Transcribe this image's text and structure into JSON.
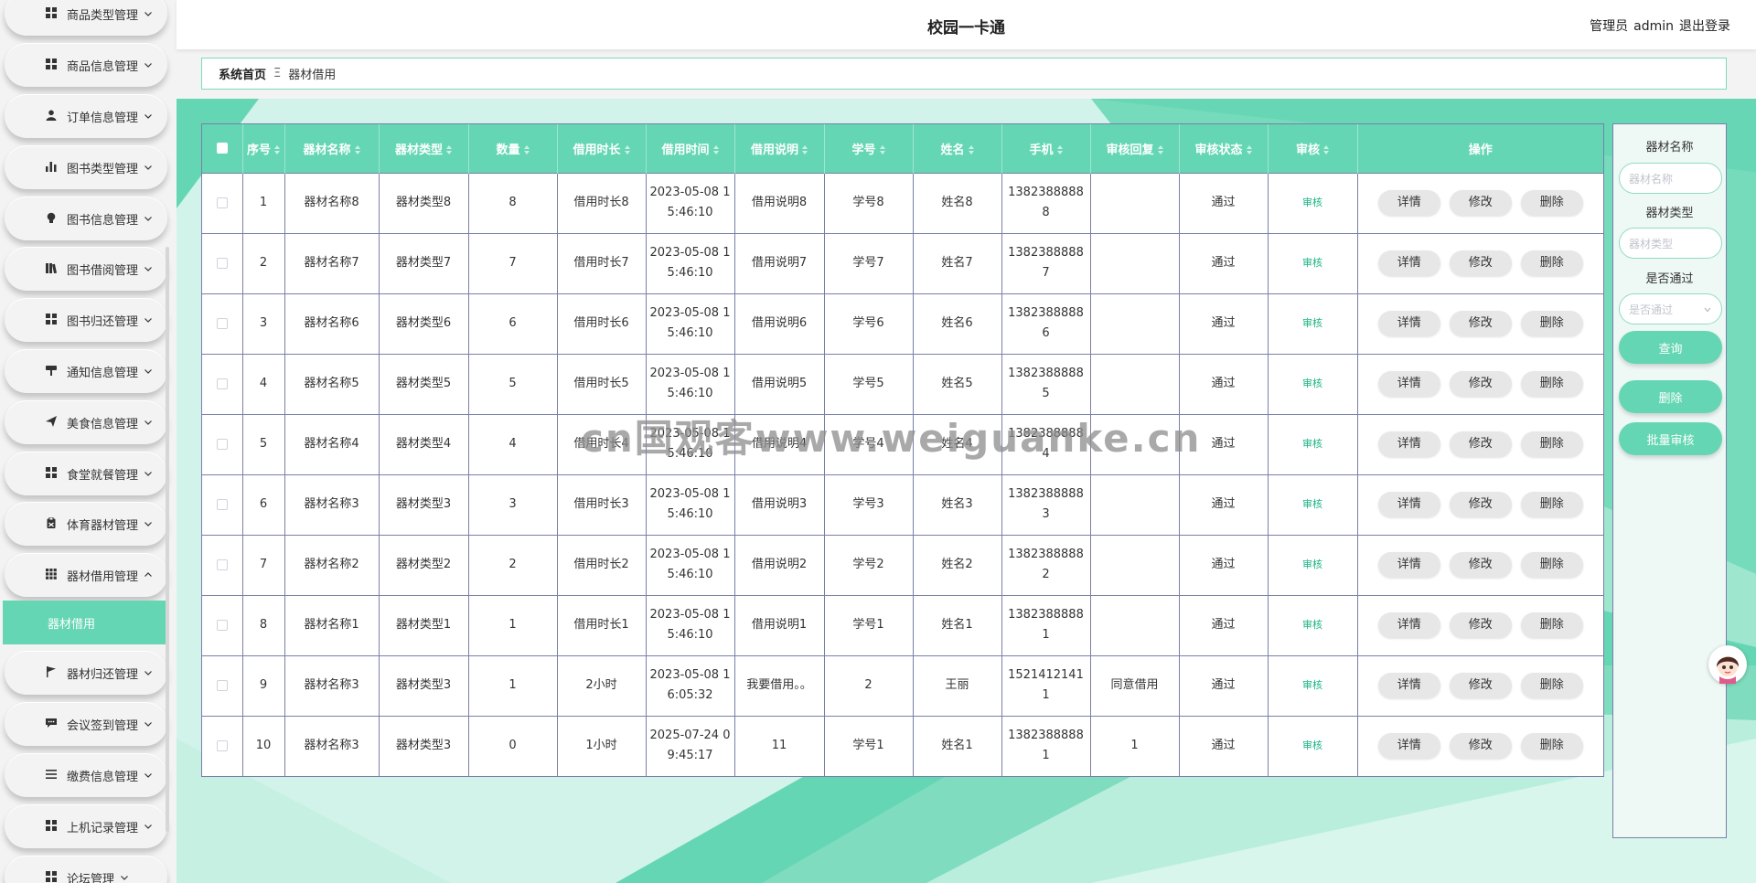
{
  "header": {
    "app_title": "校园一卡通",
    "admin_role": "管理员",
    "admin_name": "admin",
    "logout_label": "退出登录"
  },
  "sidebar": {
    "items": [
      {
        "label": "商品类型管理",
        "icon": "grid-icon"
      },
      {
        "label": "商品信息管理",
        "icon": "grid-icon"
      },
      {
        "label": "订单信息管理",
        "icon": "user-icon"
      },
      {
        "label": "图书类型管理",
        "icon": "bar-chart-icon"
      },
      {
        "label": "图书信息管理",
        "icon": "bulb-icon"
      },
      {
        "label": "图书借阅管理",
        "icon": "books-icon"
      },
      {
        "label": "图书归还管理",
        "icon": "grid-icon"
      },
      {
        "label": "通知信息管理",
        "icon": "shop-sign-icon"
      },
      {
        "label": "美食信息管理",
        "icon": "send-icon"
      },
      {
        "label": "食堂就餐管理",
        "icon": "grid-icon"
      },
      {
        "label": "体育器材管理",
        "icon": "clipboard-icon"
      },
      {
        "label": "器材借用管理",
        "icon": "grid9-icon"
      },
      {
        "label": "器材归还管理",
        "icon": "flag-icon"
      },
      {
        "label": "会议签到管理",
        "icon": "chat-icon"
      },
      {
        "label": "缴费信息管理",
        "icon": "list-icon"
      },
      {
        "label": "上机记录管理",
        "icon": "grid-icon"
      },
      {
        "label": "论坛管理",
        "icon": "grid-icon"
      }
    ],
    "active_sub_label": "器材借用"
  },
  "breadcrumb": {
    "home": "系统首页",
    "separator": "Ξ",
    "current": "器材借用"
  },
  "table": {
    "columns": [
      "序号",
      "器材名称",
      "器材类型",
      "数量",
      "借用时长",
      "借用时间",
      "借用说明",
      "学号",
      "姓名",
      "手机",
      "审核回复",
      "审核状态",
      "审核",
      "操作"
    ],
    "rows": [
      {
        "index": "1",
        "name": "器材名称8",
        "type": "器材类型8",
        "qty": "8",
        "duration": "借用时长8",
        "time": "2023-05-08 15:46:10",
        "desc": "借用说明8",
        "student_id": "学号8",
        "student_name": "姓名8",
        "phone": "13823888888",
        "reply": "",
        "status": "通过"
      },
      {
        "index": "2",
        "name": "器材名称7",
        "type": "器材类型7",
        "qty": "7",
        "duration": "借用时长7",
        "time": "2023-05-08 15:46:10",
        "desc": "借用说明7",
        "student_id": "学号7",
        "student_name": "姓名7",
        "phone": "13823888887",
        "reply": "",
        "status": "通过"
      },
      {
        "index": "3",
        "name": "器材名称6",
        "type": "器材类型6",
        "qty": "6",
        "duration": "借用时长6",
        "time": "2023-05-08 15:46:10",
        "desc": "借用说明6",
        "student_id": "学号6",
        "student_name": "姓名6",
        "phone": "13823888886",
        "reply": "",
        "status": "通过"
      },
      {
        "index": "4",
        "name": "器材名称5",
        "type": "器材类型5",
        "qty": "5",
        "duration": "借用时长5",
        "time": "2023-05-08 15:46:10",
        "desc": "借用说明5",
        "student_id": "学号5",
        "student_name": "姓名5",
        "phone": "13823888885",
        "reply": "",
        "status": "通过"
      },
      {
        "index": "5",
        "name": "器材名称4",
        "type": "器材类型4",
        "qty": "4",
        "duration": "借用时长4",
        "time": "2023-05-08 15:46:10",
        "desc": "借用说明4",
        "student_id": "学号4",
        "student_name": "姓名4",
        "phone": "13823888884",
        "reply": "",
        "status": "通过"
      },
      {
        "index": "6",
        "name": "器材名称3",
        "type": "器材类型3",
        "qty": "3",
        "duration": "借用时长3",
        "time": "2023-05-08 15:46:10",
        "desc": "借用说明3",
        "student_id": "学号3",
        "student_name": "姓名3",
        "phone": "13823888883",
        "reply": "",
        "status": "通过"
      },
      {
        "index": "7",
        "name": "器材名称2",
        "type": "器材类型2",
        "qty": "2",
        "duration": "借用时长2",
        "time": "2023-05-08 15:46:10",
        "desc": "借用说明2",
        "student_id": "学号2",
        "student_name": "姓名2",
        "phone": "13823888882",
        "reply": "",
        "status": "通过"
      },
      {
        "index": "8",
        "name": "器材名称1",
        "type": "器材类型1",
        "qty": "1",
        "duration": "借用时长1",
        "time": "2023-05-08 15:46:10",
        "desc": "借用说明1",
        "student_id": "学号1",
        "student_name": "姓名1",
        "phone": "13823888881",
        "reply": "",
        "status": "通过"
      },
      {
        "index": "9",
        "name": "器材名称3",
        "type": "器材类型3",
        "qty": "1",
        "duration": "2小时",
        "time": "2023-05-08 16:05:32",
        "desc": "我要借用。。",
        "student_id": "2",
        "student_name": "王丽",
        "phone": "15214121411",
        "reply": "同意借用",
        "status": "通过"
      },
      {
        "index": "10",
        "name": "器材名称3",
        "type": "器材类型3",
        "qty": "0",
        "duration": "1小时",
        "time": "2025-07-24 09:45:17",
        "desc": "11",
        "student_id": "学号1",
        "student_name": "姓名1",
        "phone": "13823888881",
        "reply": "1",
        "status": "通过"
      }
    ],
    "audit_link_label": "审核",
    "actions": {
      "detail": "详情",
      "edit": "修改",
      "delete": "删除"
    }
  },
  "filter_panel": {
    "name_label": "器材名称",
    "name_placeholder": "器材名称",
    "type_label": "器材类型",
    "type_placeholder": "器材类型",
    "passed_label": "是否通过",
    "passed_placeholder": "是否通过",
    "query_button": "查询",
    "delete_button": "删除",
    "batch_audit_button": "批量审核"
  },
  "watermark": "cn国观客www.weiguanke.cn",
  "colors": {
    "accent": "#65d6b3",
    "accent_dark": "#3fc39c",
    "audit_link": "#1bb385",
    "table_border": "#7a7fa8"
  }
}
